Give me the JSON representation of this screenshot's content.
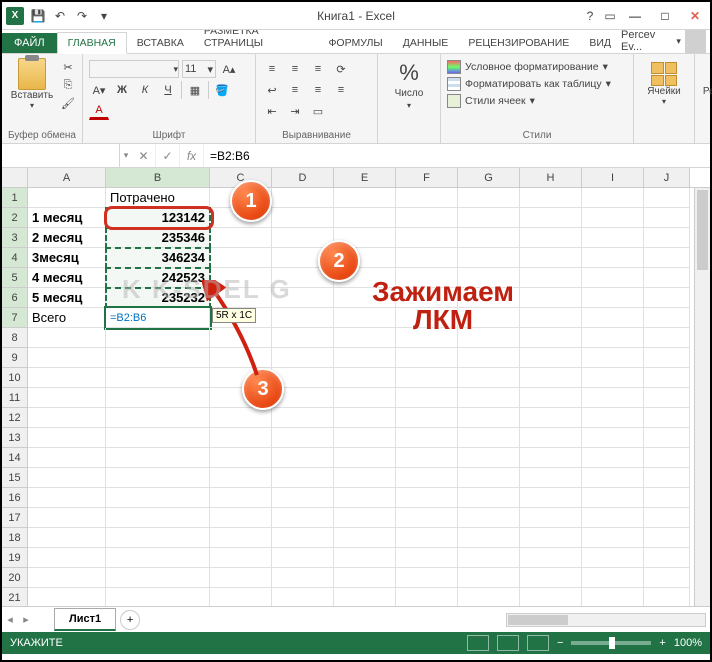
{
  "title": "Книга1 - Excel",
  "tabs": {
    "file": "ФАЙЛ",
    "home": "ГЛАВНАЯ",
    "insert": "ВСТАВКА",
    "pageLayout": "РАЗМЕТКА СТРАНИЦЫ",
    "formulas": "ФОРМУЛЫ",
    "data": "ДАННЫЕ",
    "review": "РЕЦЕНЗИРОВАНИЕ",
    "view": "ВИД"
  },
  "user": "Percev Ev...",
  "ribbon": {
    "paste": "Вставить",
    "clipboard": "Буфер обмена",
    "font": "Шрифт",
    "fontSize": "11",
    "alignment": "Выравнивание",
    "number": "Число",
    "styles": "Стили",
    "conditional": "Условное форматирование",
    "formatTable": "Форматировать как таблицу",
    "cellStyles": "Стили ячеек",
    "cells": "Ячейки",
    "editing": "Редактирование"
  },
  "nameBox": "",
  "formulaBar": "=B2:B6",
  "columns": [
    "A",
    "B",
    "C",
    "D",
    "E",
    "F",
    "G",
    "H",
    "I",
    "J"
  ],
  "sheetData": {
    "b1": "Потрачено",
    "a2": "1 месяц",
    "b2": "123142",
    "a3": "2 месяц",
    "b3": "235346",
    "a4": "3месяц",
    "b4": "346234",
    "a5": "4 месяц",
    "b5": "242523",
    "a6": "5 месяц",
    "b6": "235232",
    "a7": "Всего",
    "b7": "=B2:B6"
  },
  "selTooltip": "5R x 1C",
  "callouts": {
    "c1": "1",
    "c2": "2",
    "c3": "3"
  },
  "annotation": {
    "line1": "Зажимаем",
    "line2": "ЛКМ"
  },
  "watermark": "K K-SDEL         G",
  "sheetTab": "Лист1",
  "status": {
    "mode": "УКАЖИТЕ",
    "zoom": "100%"
  }
}
